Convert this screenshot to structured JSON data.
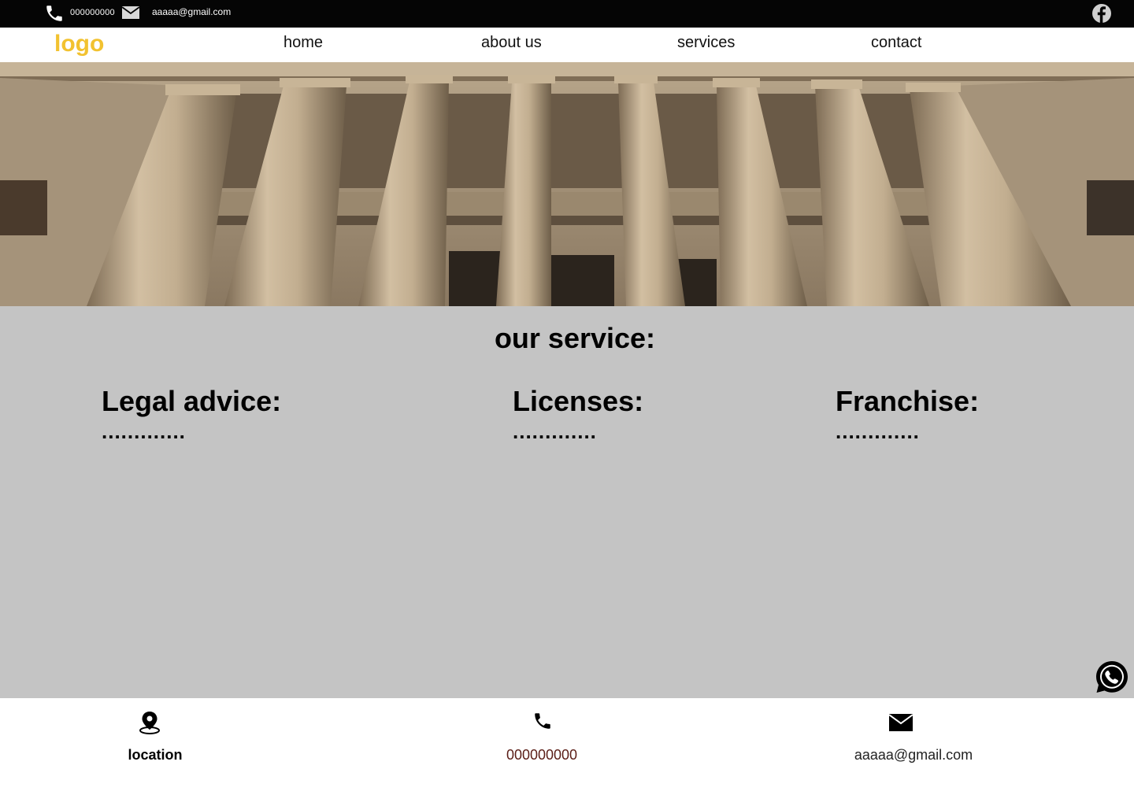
{
  "colors": {
    "topbar_bg": "#050505",
    "logo": "#f2c230",
    "services_bg": "#c4c4c4",
    "footer_phone": "#5a1d16"
  },
  "topbar": {
    "phone": "000000000",
    "email": "aaaaa@gmail.com",
    "icons": [
      "phone-icon",
      "mail-icon",
      "facebook-icon"
    ]
  },
  "nav": {
    "logo": "logo",
    "links": [
      "home",
      "about us",
      "services",
      "contact"
    ]
  },
  "hero": {
    "image": "courthouse columns photo"
  },
  "services": {
    "title": "our service:",
    "items": [
      {
        "title": "Legal advice:",
        "dots": "............."
      },
      {
        "title": "Licenses:",
        "dots": "............."
      },
      {
        "title": "Franchise:",
        "dots": "............."
      }
    ]
  },
  "footer": {
    "location": "location",
    "phone": "000000000",
    "email": "aaaaa@gmail.com",
    "icons": [
      "location-pin-icon",
      "phone-icon",
      "mail-icon",
      "whatsapp-icon"
    ]
  }
}
